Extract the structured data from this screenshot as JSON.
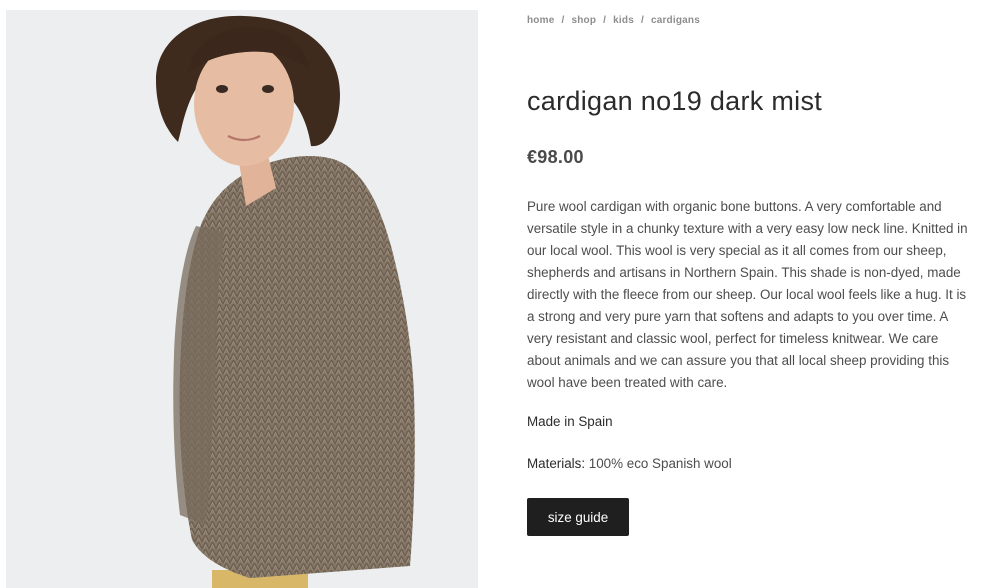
{
  "breadcrumb": [
    "home",
    "shop",
    "kids",
    "cardigans"
  ],
  "product": {
    "title": "cardigan no19 dark mist",
    "price": "€98.00",
    "description": "Pure wool cardigan with organic bone buttons. A very comfortable and versatile style in a chunky texture with a very easy low neck line. Knitted in our local wool. This wool is very special as it all comes from our sheep, shepherds and artisans in Northern Spain. This shade is non-dyed, made directly with the fleece from our sheep. Our local wool feels like a hug. It is a strong and very pure yarn that softens and adapts to you over time. A very resistant and classic wool, perfect for timeless knitwear. We care about animals and we can assure you that all local sheep providing this wool have been treated with care.",
    "made_in": "Made in Spain",
    "materials_label": "Materials:",
    "materials_value": "100% eco Spanish wool",
    "size_guide_label": "size guide"
  },
  "colors": {
    "button_bg": "#1f1f1f",
    "cardigan": "#8a7a6a",
    "image_bg": "#eceeef"
  }
}
